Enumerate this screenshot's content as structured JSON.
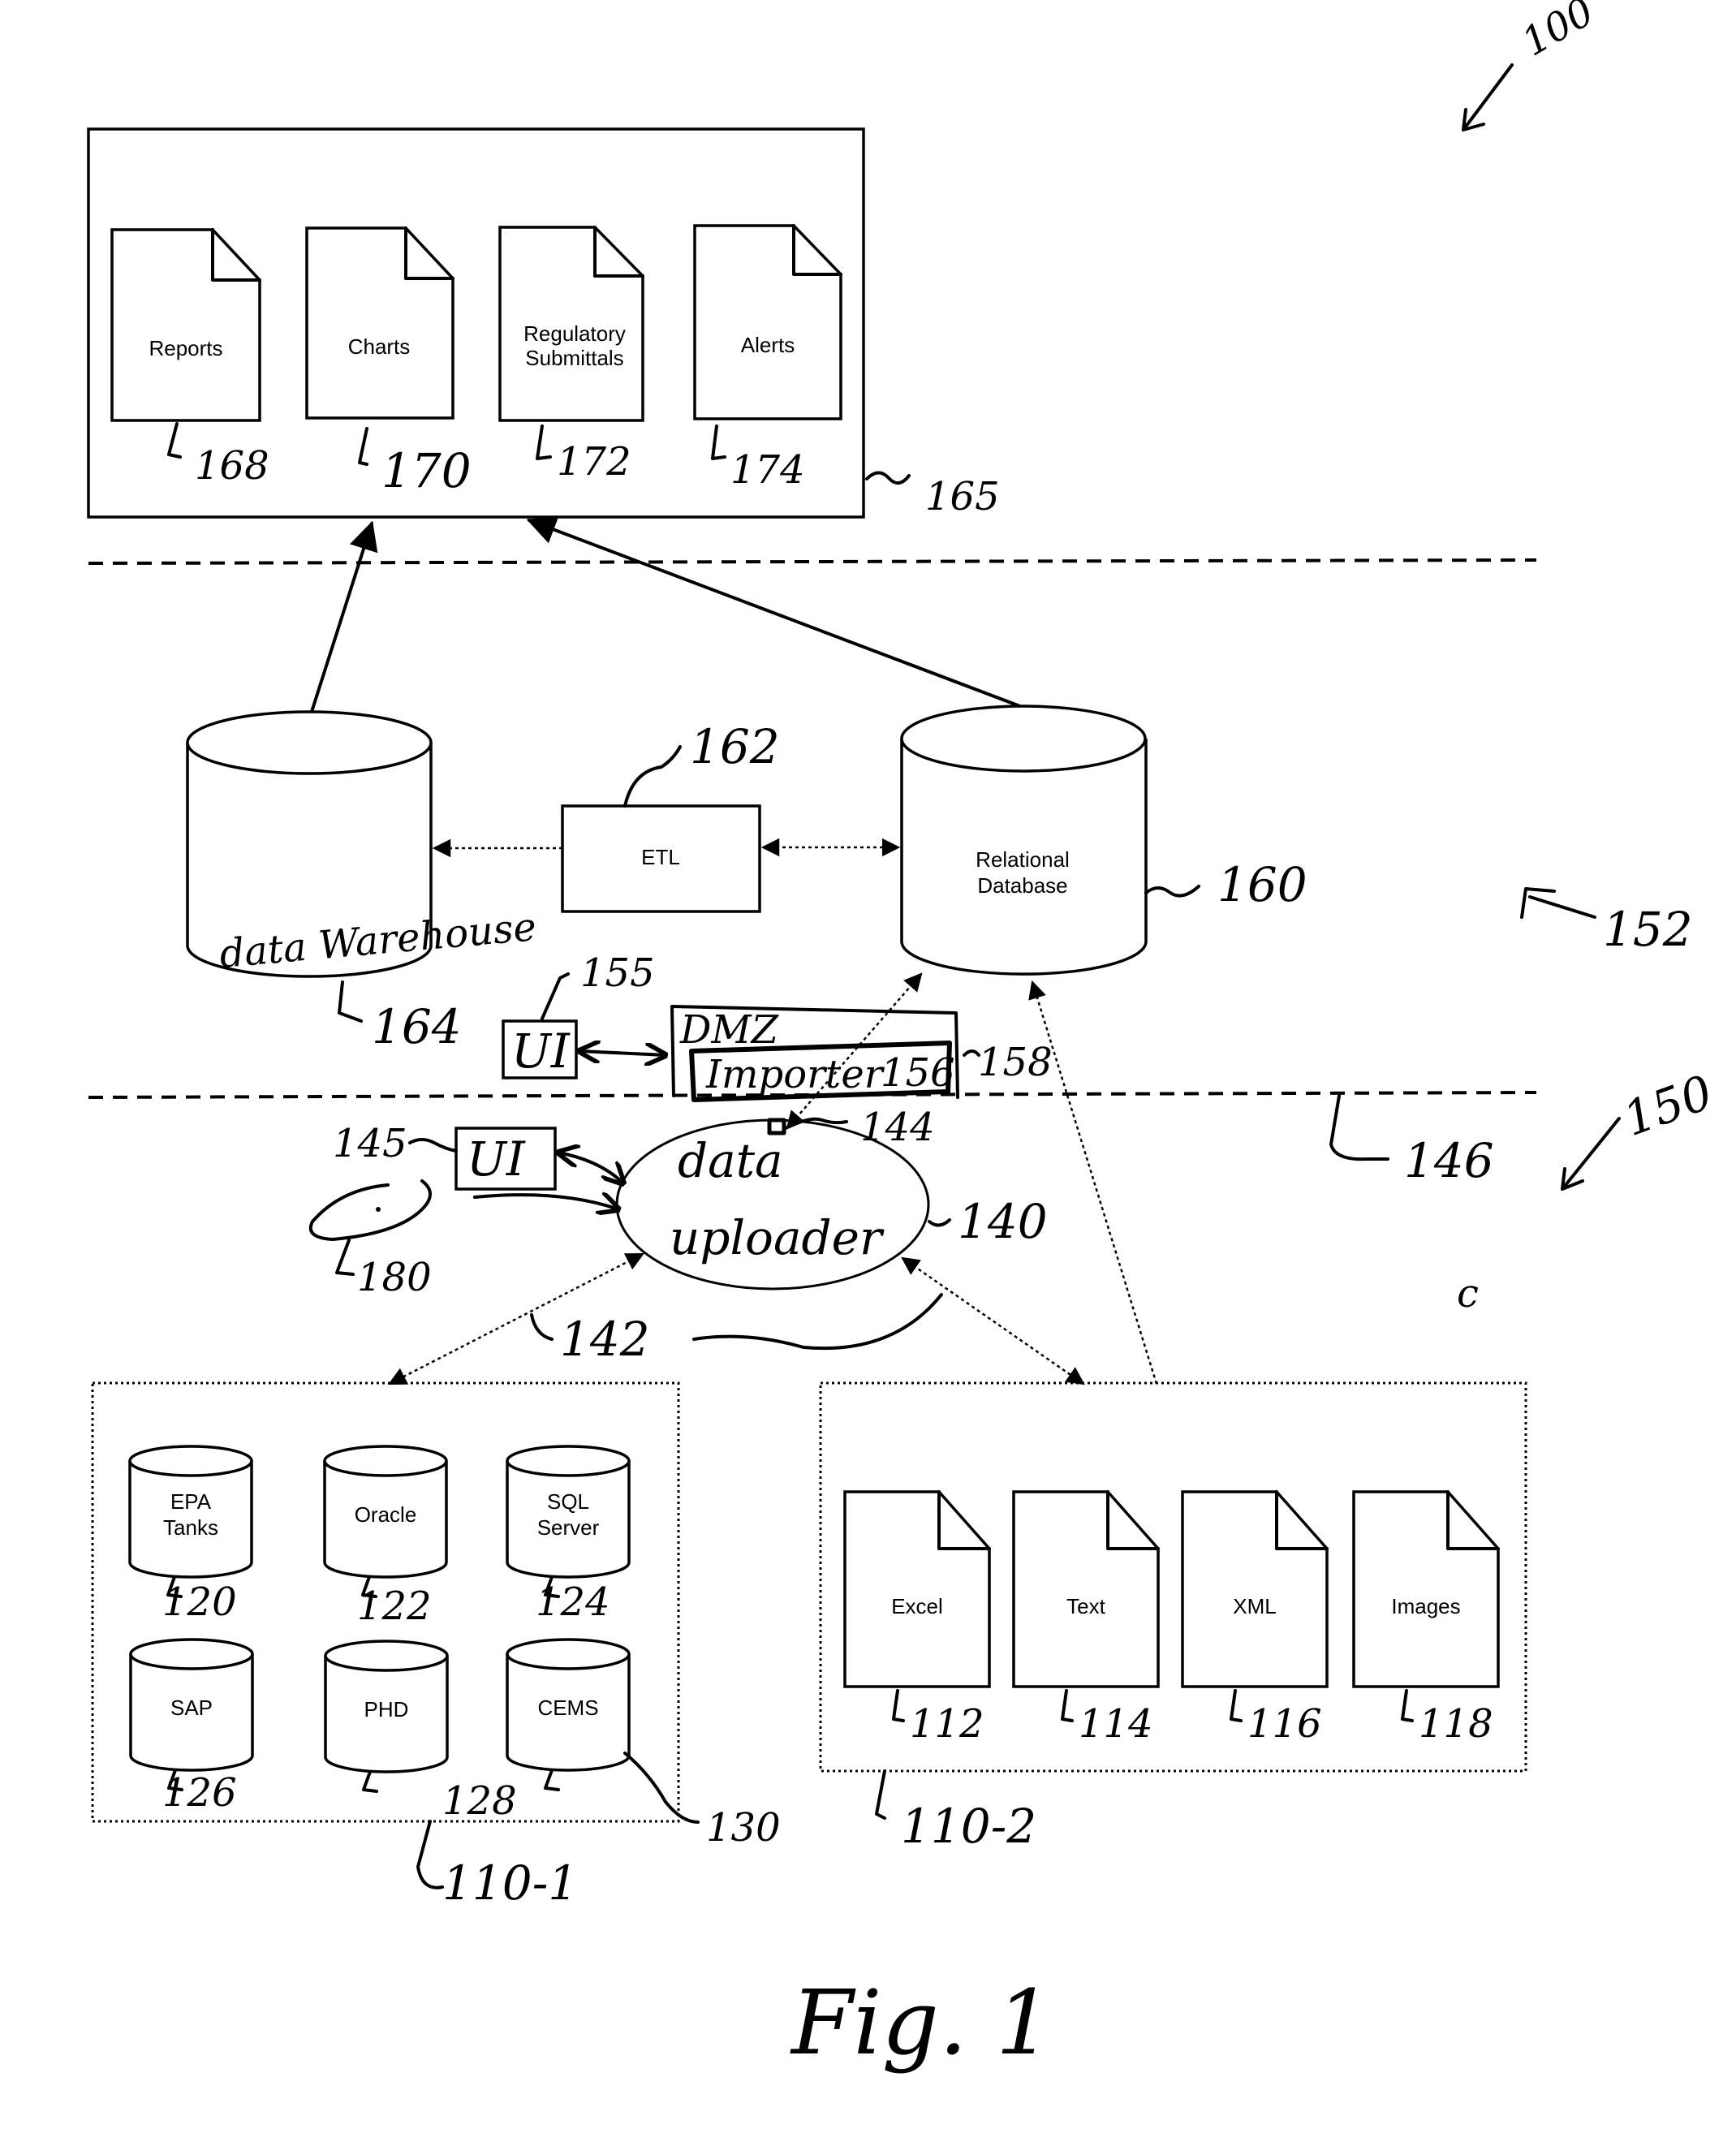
{
  "figure": {
    "caption": "Fig. 1",
    "system_ref": "100"
  },
  "output_layer": {
    "ref": "165",
    "documents": [
      {
        "label_lines": [
          "Reports"
        ],
        "ref": "168"
      },
      {
        "label_lines": [
          "Charts"
        ],
        "ref": "170"
      },
      {
        "label_lines": [
          "Regulatory",
          "Submittals"
        ],
        "ref": "172"
      },
      {
        "label_lines": [
          "Alerts"
        ],
        "ref": "174"
      }
    ]
  },
  "server_layer": {
    "ref": "152",
    "data_warehouse": {
      "label": "data Warehouse",
      "ref": "164"
    },
    "etl": {
      "label": "ETL",
      "ref": "162"
    },
    "relational_db": {
      "label_lines": [
        "Relational",
        "Database"
      ],
      "ref": "160"
    },
    "ui": {
      "label": "UI",
      "ref": "155"
    },
    "dmz": {
      "label": "DMZ",
      "ref": "158"
    },
    "importer": {
      "label": "Importer",
      "ref": "156"
    }
  },
  "boundary": {
    "ref": "146"
  },
  "client_layer": {
    "ref": "150",
    "stray_mark": "c",
    "data_uploader": {
      "label_lines": [
        "data",
        "uploader"
      ],
      "ref": "140"
    },
    "connector_ref": "144",
    "ui": {
      "label": "UI",
      "ref": "145"
    },
    "user_device": {
      "ref": "180"
    },
    "link_ref": "142"
  },
  "database_sources": {
    "ref": "110-1",
    "items": [
      {
        "label_lines": [
          "EPA",
          "Tanks"
        ],
        "ref": "120"
      },
      {
        "label_lines": [
          "Oracle"
        ],
        "ref": "122"
      },
      {
        "label_lines": [
          "SQL",
          "Server"
        ],
        "ref": "124"
      },
      {
        "label_lines": [
          "SAP"
        ],
        "ref": "126"
      },
      {
        "label_lines": [
          "PHD"
        ],
        "ref": "128"
      },
      {
        "label_lines": [
          "CEMS"
        ],
        "ref": "130"
      }
    ]
  },
  "file_sources": {
    "ref": "110-2",
    "items": [
      {
        "label_lines": [
          "Excel"
        ],
        "ref": "112"
      },
      {
        "label_lines": [
          "Text"
        ],
        "ref": "114"
      },
      {
        "label_lines": [
          "XML"
        ],
        "ref": "116"
      },
      {
        "label_lines": [
          "Images"
        ],
        "ref": "118"
      }
    ]
  }
}
